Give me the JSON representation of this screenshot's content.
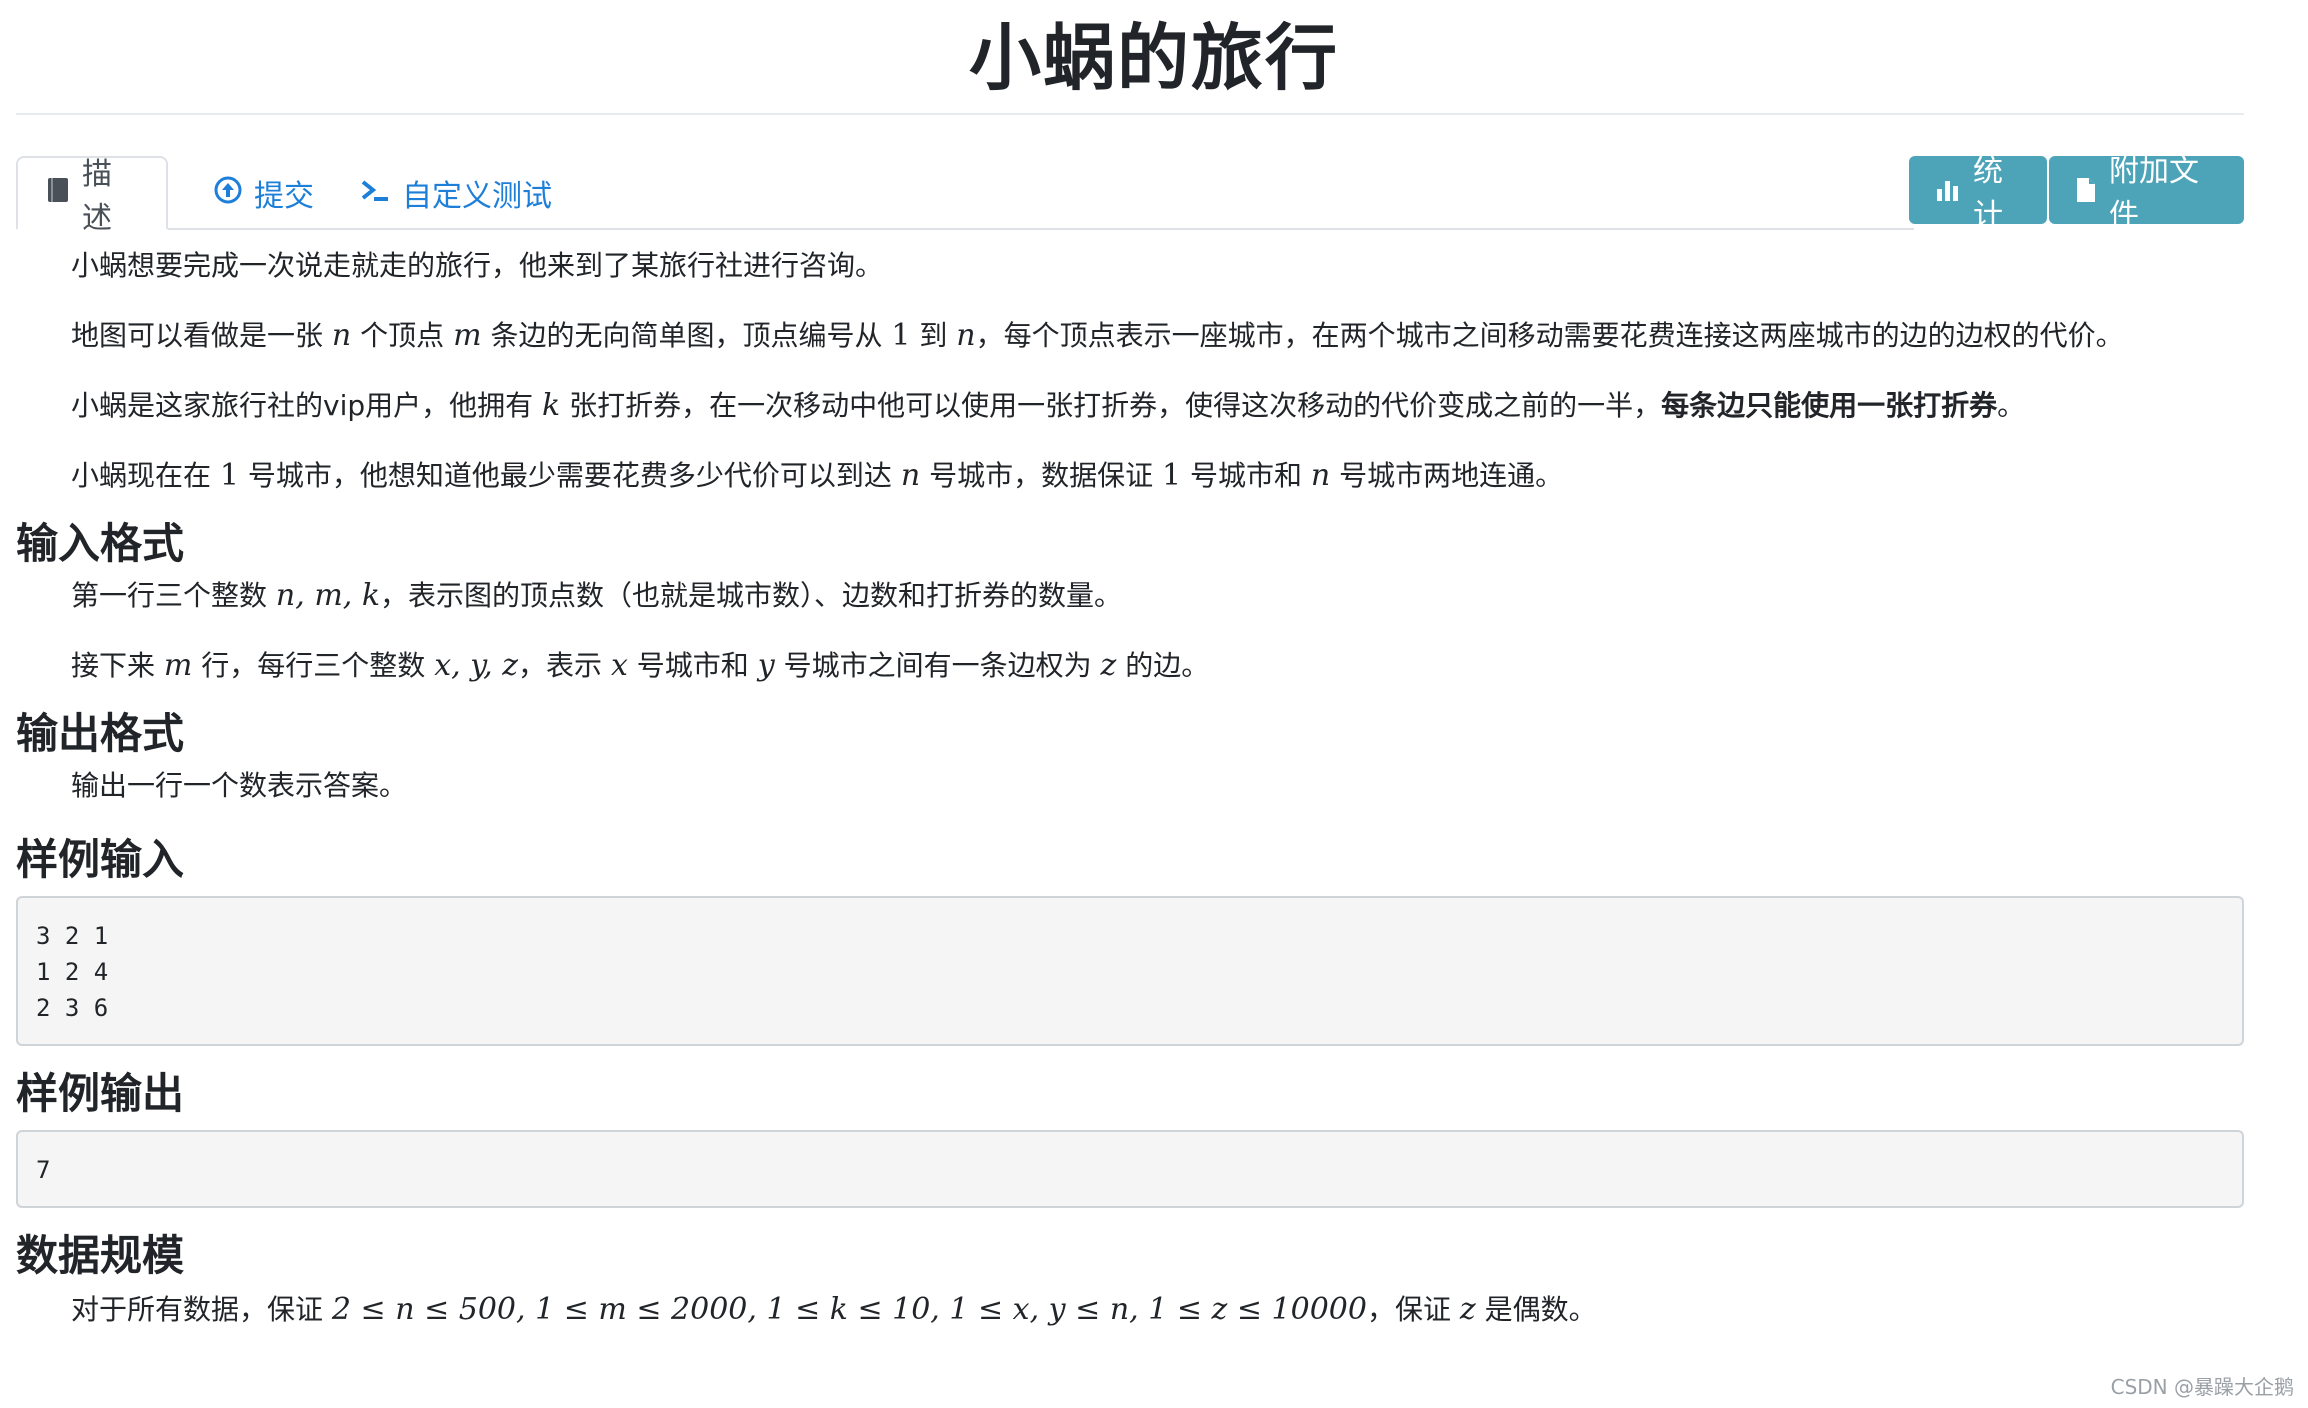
{
  "title": "小蜗的旅行",
  "tabs": [
    {
      "label": "描述",
      "icon": "book-icon",
      "active": true
    },
    {
      "label": "提交",
      "icon": "upload-circle-icon"
    },
    {
      "label": "自定义测试",
      "icon": "terminal-icon"
    }
  ],
  "buttons": [
    {
      "label": "统计",
      "icon": "bar-chart-icon"
    },
    {
      "label": "附加文件",
      "icon": "file-icon"
    }
  ],
  "colors": {
    "link": "#1e7fd9",
    "button": "#4da4b8"
  },
  "description": {
    "p1": "小蜗想要完成一次说走就走的旅行，他来到了某旅行社进行咨询。",
    "p2": {
      "a": "地图可以看做是一张",
      "n": "n",
      "b": "个顶点",
      "m": "m",
      "c": "条边的无向简单图，顶点编号从",
      "one": "1",
      "d": "到",
      "n2": "n",
      "e": "，每个顶点表示一座城市，在两个城市之间移动需要花费连接这两座城市的边的边权的代价。"
    },
    "p3": {
      "a": "小蜗是这家旅行社的vip用户，他拥有",
      "k": "k",
      "b": "张打折券，在一次移动中他可以使用一张打折券，使得这次移动的代价变成之前的一半，",
      "bold": "每条边只能使用一张打折券",
      "c": "。"
    },
    "p4": {
      "a": "小蜗现在在",
      "one": "1",
      "b": "号城市，他想知道他最少需要花费多少代价可以到达",
      "n": "n",
      "c": "号城市，数据保证",
      "one2": "1",
      "d": "号城市和",
      "n2": "n",
      "e": "号城市两地连通。"
    }
  },
  "input_format": {
    "heading": "输入格式",
    "p1": {
      "a": "第一行三个整数",
      "vars": "n, m, k",
      "b": "，表示图的顶点数（也就是城市数）、边数和打折券的数量。"
    },
    "p2": {
      "a": "接下来",
      "m": "m",
      "b": "行，每行三个整数",
      "vars": "x, y, z",
      "c": "，表示",
      "x": "x",
      "d": "号城市和",
      "y": "y",
      "e": "号城市之间有一条边权为",
      "z": "z",
      "f": "的边。"
    }
  },
  "output_format": {
    "heading": "输出格式",
    "p1": "输出一行一个数表示答案。"
  },
  "sample_input": {
    "heading": "样例输入",
    "content": "3 2 1\n1 2 4\n2 3 6"
  },
  "sample_output": {
    "heading": "样例输出",
    "content": "7"
  },
  "constraints": {
    "heading": "数据规模",
    "a": "对于所有数据，保证",
    "math": "2 ≤ n ≤ 500, 1 ≤ m ≤ 2000, 1 ≤ k ≤ 10, 1 ≤ x, y ≤ n, 1 ≤ z ≤ 10000",
    "b": "，保证",
    "z": "z",
    "c": "是偶数。"
  },
  "watermark": "CSDN @暴躁大企鹅"
}
